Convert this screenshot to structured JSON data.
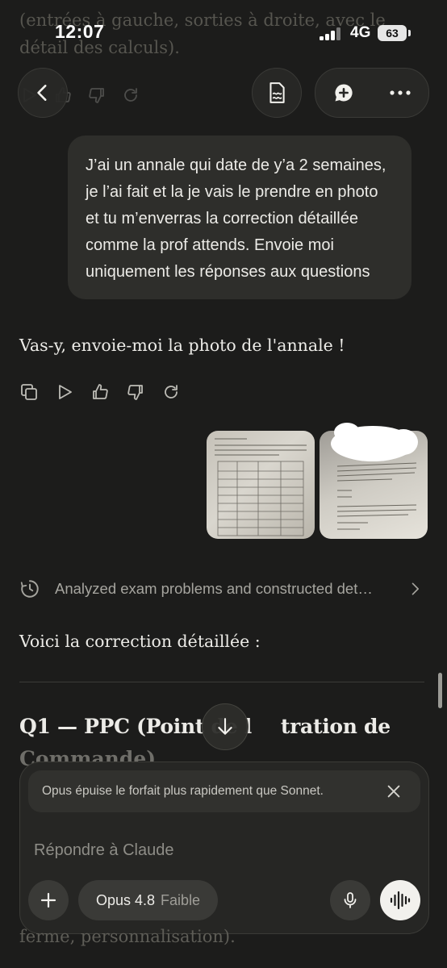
{
  "background_text": {
    "top": "(entrées à gauche, sorties à droite, avec le détail des calculs).",
    "bottom": "ferme, personnalisation)."
  },
  "status_bar": {
    "time": "12:07",
    "network": "4G",
    "battery": "63"
  },
  "header": {
    "back_icon": "chevron-left-icon",
    "document_icon": "document-icon",
    "new_chat_icon": "chat-plus-icon",
    "more_icon": "ellipsis-icon"
  },
  "conversation": {
    "user_message": "J’ai un annale qui date de y’a 2 semaines, je l’ai fait et la je vais le prendre en photo et tu m’enverras la correction détaillée comme la prof attends. Envoie moi uniquement les réponses aux questions",
    "assistant_reply": "Vas-y, envoie-moi la photo de l'annale !",
    "actions": [
      "copy-icon",
      "play-icon",
      "thumbs-up-icon",
      "thumbs-down-icon",
      "retry-icon"
    ],
    "thinking_summary": "Analyzed exam problems and constructed det…",
    "correction_intro": "Voici la correction détaillée :",
    "q1_heading_line1": "Q1 — PPC (Point de l",
    "q1_heading_line1_end": "tration de",
    "q1_heading_line2": "Commande)"
  },
  "composer": {
    "notice": "Opus épuise le forfait plus rapidement que Sonnet.",
    "placeholder": "Répondre à Claude",
    "model": "Opus 4.8",
    "effort": "Faible"
  },
  "colors": {
    "background": "#1c1c1b",
    "bubble": "#2e2e2b",
    "text": "#ecebe7",
    "muted": "#a6a59f"
  }
}
